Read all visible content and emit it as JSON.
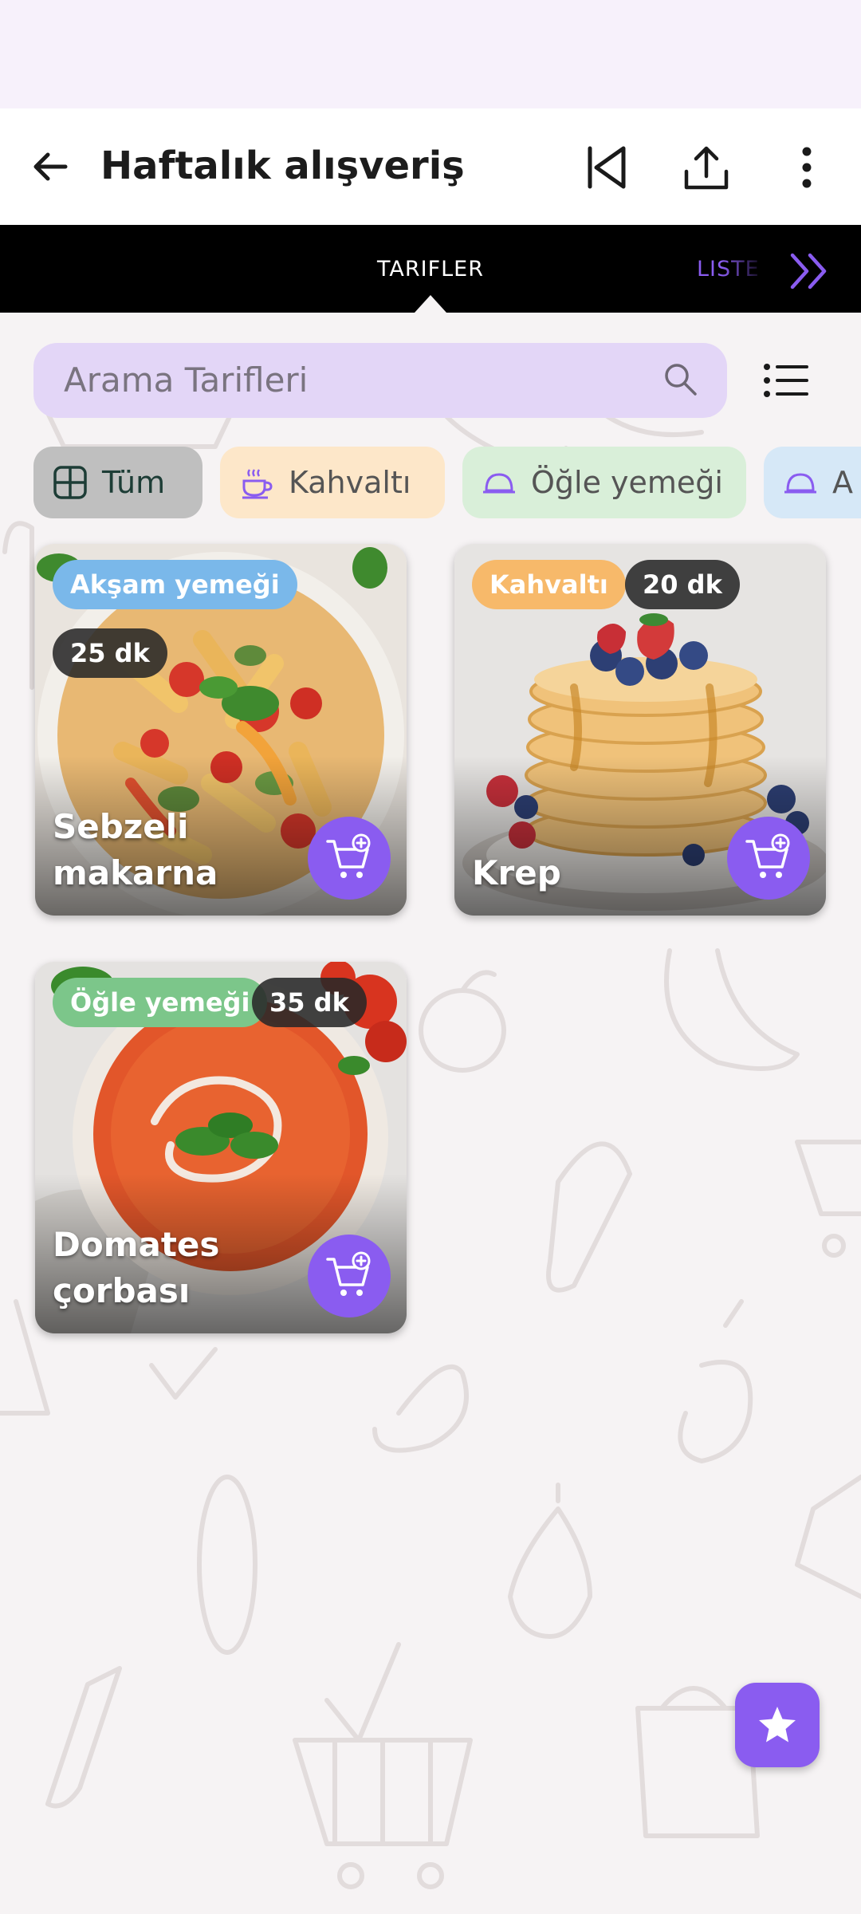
{
  "appbar": {
    "title": "Haftalık alışveriş",
    "back_icon": "arrow-left-icon",
    "actions": [
      "skip-previous-icon",
      "share-icon",
      "more-vertical-icon"
    ]
  },
  "tabs": {
    "recipes": "TARIFLER",
    "list": "LISTE",
    "more_icon": "double-chevron-right-icon"
  },
  "search": {
    "placeholder": "Arama Tarifleri",
    "icon": "search-icon"
  },
  "filters": [
    {
      "label": "Tüm",
      "icon": "grid-icon",
      "selected": true
    },
    {
      "label": "Kahvaltı",
      "icon": "coffee-cup-icon",
      "selected": false
    },
    {
      "label": "Öğle yemeği",
      "icon": "cloche-icon",
      "selected": false
    },
    {
      "label": "A",
      "icon": "cloche-icon",
      "selected": false
    }
  ],
  "recipes": [
    {
      "name": "Sebzeli makarna",
      "category": "Akşam yemeği",
      "time": "25 dk",
      "category_color": "#7ab8ea"
    },
    {
      "name": "Krep",
      "category": "Kahvaltı",
      "time": "20 dk",
      "category_color": "#f7b96a"
    },
    {
      "name": "Domates çorbası",
      "category": "Öğle yemeği",
      "time": "35 dk",
      "category_color": "#7cc68a"
    }
  ],
  "colors": {
    "accent": "#8a5cf0",
    "search_bg": "#e3d6f7",
    "tab_bg": "#000000"
  },
  "fab_icon": "star-icon"
}
